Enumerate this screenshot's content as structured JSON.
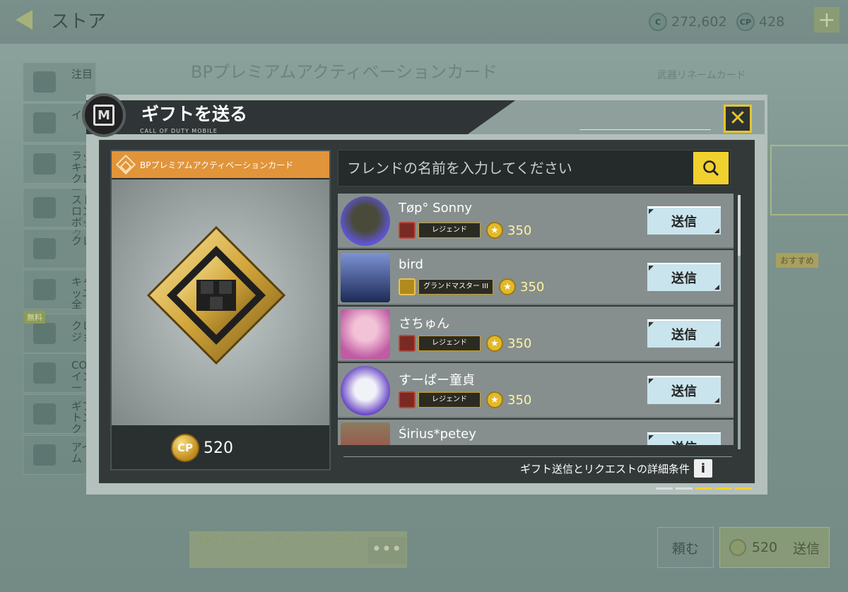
{
  "background": {
    "title": "ストア",
    "currencies": [
      {
        "icon": "C",
        "value": "272,602"
      },
      {
        "icon": "CP",
        "value": "428"
      }
    ],
    "plus_label": "+",
    "sidebar": [
      {
        "label": "注目"
      },
      {
        "label": "イ"
      },
      {
        "label": "ラッキークレー"
      },
      {
        "label": "ストロンボック"
      },
      {
        "label": "クレ"
      },
      {
        "label": "キャッユ全"
      },
      {
        "label": "クレジョ"
      },
      {
        "label": "CODインー"
      },
      {
        "label": "ギフトンク"
      },
      {
        "label": "アイム"
      }
    ],
    "free_badge": "無料",
    "heading": "BPプレミアムアクティベーションカード",
    "rename_card": "武器リネームカード",
    "recommend_badge": "おすすめ",
    "bottom_card": "BPプレミアムアクティベーションカード",
    "more_label": "•••",
    "request_button": "頼む",
    "send_button": {
      "price": "520",
      "label": "送信"
    }
  },
  "modal": {
    "title": "ギフトを送る",
    "subtitle": "CALL OF DUTY MOBILE",
    "close_label": "✕",
    "item": {
      "name": "BPプレミアムアクティベーションカード",
      "price": "520",
      "currency": "CP"
    },
    "search": {
      "placeholder": "フレンドの名前を入力してください",
      "value": ""
    },
    "friends": [
      {
        "name": "Tøp° Sonny",
        "rank": "レジェンド",
        "score": "350",
        "send_label": "送信",
        "avatar_colors": [
          "#5e55d8",
          "#4a4a3a"
        ]
      },
      {
        "name": "bird",
        "rank": "グランドマスター III",
        "score": "350",
        "send_label": "送信",
        "avatar_colors": [
          "#1c2a56",
          "#7c92d4"
        ]
      },
      {
        "name": "さちゅん",
        "rank": "レジェンド",
        "score": "350",
        "send_label": "送信",
        "avatar_colors": [
          "#c05ba4",
          "#f2c2d6"
        ]
      },
      {
        "name": "すーぱー童貞",
        "rank": "レジェンド",
        "score": "350",
        "send_label": "送信",
        "avatar_colors": [
          "#6440c4",
          "#f1f1f8"
        ]
      },
      {
        "name": "Śirius*petey",
        "rank": "",
        "score": "",
        "send_label": "送信",
        "avatar_colors": [
          "#8b7b5e",
          "#a33b3b"
        ]
      }
    ],
    "terms_label": "ギフト送信とリクエストの詳細条件",
    "info_label": "i",
    "colors": {
      "accent": "#f1d12e",
      "label_bg": "#e1943a",
      "send_bg": "#c9e4ec"
    }
  }
}
